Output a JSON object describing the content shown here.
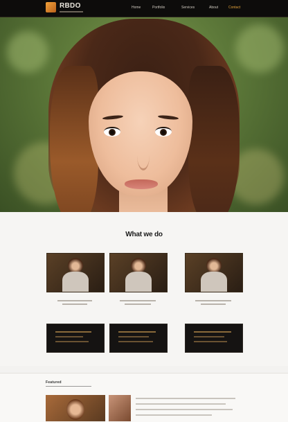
{
  "brand": {
    "name": "RBDO"
  },
  "nav": [
    {
      "label": "Home",
      "active": false
    },
    {
      "label": "Portfolio",
      "active": false
    },
    {
      "label": "Services",
      "active": false
    },
    {
      "label": "About",
      "active": false
    },
    {
      "label": "Contact",
      "active": true
    }
  ],
  "hero": {
    "image": "portrait of woman with long brown hair, green bokeh background"
  },
  "section": {
    "heading": "What we do",
    "cards": [
      {
        "image": "portrait-thumbnail"
      },
      {
        "image": "portrait-thumbnail"
      },
      {
        "image": "portrait-thumbnail"
      }
    ]
  },
  "lower": {
    "heading": "Featured"
  },
  "colors": {
    "accent": "#e3a23a",
    "topbar": "#0d0c0b",
    "dark_card": "#151312"
  }
}
